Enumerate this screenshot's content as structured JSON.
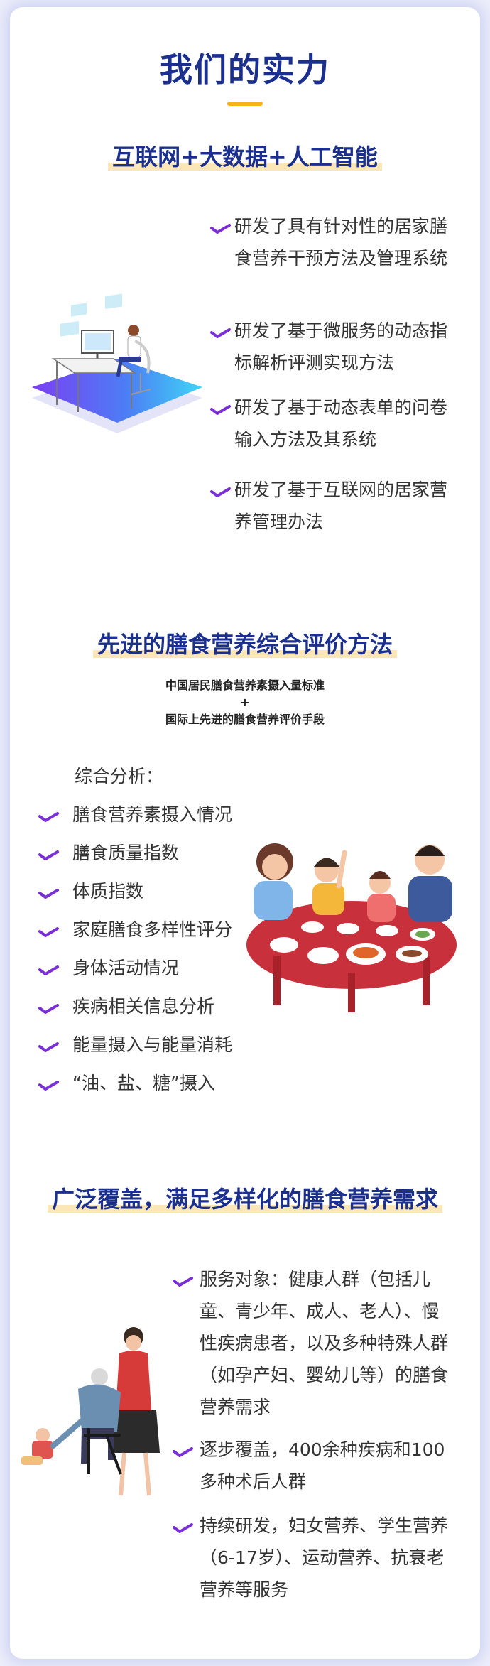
{
  "title": "我们的实力",
  "sections": [
    {
      "heading": "互联网+大数据+人工智能",
      "items": [
        "研发了具有针对性的居家膳食营养干预方法及管理系统",
        "研发了基于微服务的动态指标解析评测实现方法",
        "研发了基于动态表单的问卷输入方法及其系统",
        "研发了基于互联网的居家营养管理办法"
      ]
    },
    {
      "heading": "先进的膳食营养综合评价方法",
      "subtitle_lines": [
        "中国居民膳食营养素摄入量标准",
        "+",
        "国际上先进的膳食营养评价手段"
      ],
      "analysis_label": "综合分析：",
      "items": [
        "膳食营养素摄入情况",
        "膳食质量指数",
        "体质指数",
        "家庭膳食多样性评分",
        "身体活动情况",
        "疾病相关信息分析",
        "能量摄入与能量消耗",
        "“油、盐、糖”摄入"
      ]
    },
    {
      "heading": "广泛覆盖，满足多样化的膳食营养需求",
      "items": [
        "服务对象：健康人群（包括儿童、青少年、成人、老人）、慢性疾病患者，以及多种特殊人群（如孕产妇、婴幼儿等）的膳食营养需求",
        "逐步覆盖，400余种疾病和100多种术后人群",
        "持续研发，妇女营养、学生营养（6-17岁）、运动营养、抗衰老营养等服务"
      ]
    }
  ],
  "colors": {
    "title": "#1b2f8f",
    "check": "#7b2fd6",
    "highlight": "#fbe6b7",
    "bar": "#f6b21c"
  }
}
